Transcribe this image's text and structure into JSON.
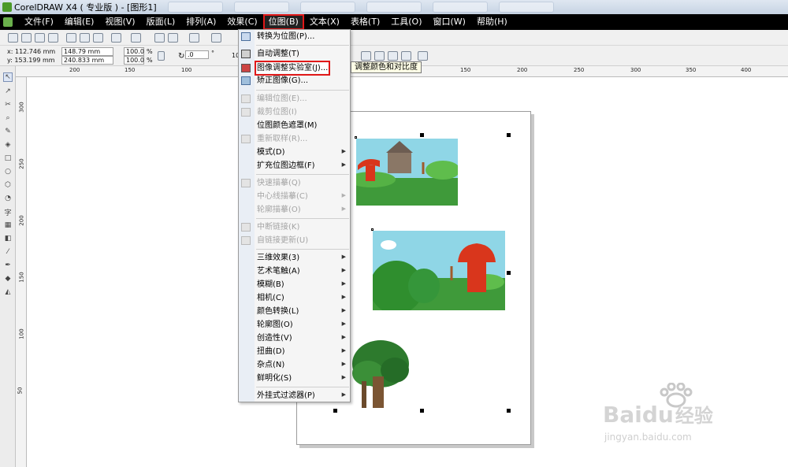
{
  "window": {
    "title": "CorelDRAW X4 ( 专业版 ) - [图形1]"
  },
  "menubar": {
    "items": [
      "文件(F)",
      "编辑(E)",
      "视图(V)",
      "版面(L)",
      "排列(A)",
      "效果(C)",
      "位图(B)",
      "文本(X)",
      "表格(T)",
      "工具(O)",
      "窗口(W)",
      "帮助(H)"
    ],
    "active_index": 6
  },
  "properties": {
    "x": "x: 112.746 mm",
    "y": "y: 153.199 mm",
    "width": "148.79 mm",
    "height": "240.833 mm",
    "scale_x": "100.0",
    "scale_y": "100.0",
    "percent": "%",
    "rotation": ".0",
    "degree": "°",
    "right_value": "10"
  },
  "ruler": {
    "top_labels": [
      "200",
      "150",
      "100",
      "150",
      "200",
      "250",
      "300",
      "350",
      "400"
    ],
    "left_labels": [
      "300",
      "250",
      "200",
      "150",
      "100",
      "50"
    ]
  },
  "toolbox": {
    "text_tool": "字"
  },
  "bitmap_menu": {
    "items": [
      {
        "label": "转换为位图(P)...",
        "disabled": false,
        "submenu": false
      },
      {
        "label": "自动调整(T)",
        "disabled": false,
        "submenu": false
      },
      {
        "label": "图像调整实验室(J)...",
        "disabled": false,
        "submenu": false,
        "highlighted": true
      },
      {
        "label": "矫正图像(G)...",
        "disabled": false,
        "submenu": false
      },
      {
        "label": "编辑位图(E)...",
        "disabled": true,
        "submenu": false
      },
      {
        "label": "裁剪位图(I)",
        "disabled": true,
        "submenu": false
      },
      {
        "label": "位图颜色遮罩(M)",
        "disabled": false,
        "submenu": false
      },
      {
        "label": "重新取样(R)...",
        "disabled": true,
        "submenu": false
      },
      {
        "label": "模式(D)",
        "disabled": false,
        "submenu": true
      },
      {
        "label": "扩充位图边框(F)",
        "disabled": false,
        "submenu": true
      },
      {
        "label": "快速描摹(Q)",
        "disabled": true,
        "submenu": false
      },
      {
        "label": "中心线描摹(C)",
        "disabled": true,
        "submenu": true
      },
      {
        "label": "轮廓描摹(O)",
        "disabled": true,
        "submenu": true
      },
      {
        "label": "中断链接(K)",
        "disabled": true,
        "submenu": false
      },
      {
        "label": "自链接更新(U)",
        "disabled": true,
        "submenu": false
      },
      {
        "label": "三维效果(3)",
        "disabled": false,
        "submenu": true
      },
      {
        "label": "艺术笔触(A)",
        "disabled": false,
        "submenu": true
      },
      {
        "label": "模糊(B)",
        "disabled": false,
        "submenu": true
      },
      {
        "label": "相机(C)",
        "disabled": false,
        "submenu": true
      },
      {
        "label": "颜色转换(L)",
        "disabled": false,
        "submenu": true
      },
      {
        "label": "轮廓图(O)",
        "disabled": false,
        "submenu": true
      },
      {
        "label": "创造性(V)",
        "disabled": false,
        "submenu": true
      },
      {
        "label": "扭曲(D)",
        "disabled": false,
        "submenu": true
      },
      {
        "label": "杂点(N)",
        "disabled": false,
        "submenu": true
      },
      {
        "label": "鲜明化(S)",
        "disabled": false,
        "submenu": true
      },
      {
        "label": "外挂式过滤器(P)",
        "disabled": false,
        "submenu": true
      }
    ]
  },
  "tooltip": {
    "text": "调整颜色和对比度"
  },
  "watermark": {
    "brand": "Bai",
    "brand2": "du",
    "cn": "经验",
    "url": "jingyan.baidu.com"
  },
  "colors": {
    "menubar_bg": "#000000",
    "highlight_border": "#e01818",
    "sky": "#8fd6e6",
    "grass": "#3f9a3a",
    "mushroom": "#d9361c"
  }
}
